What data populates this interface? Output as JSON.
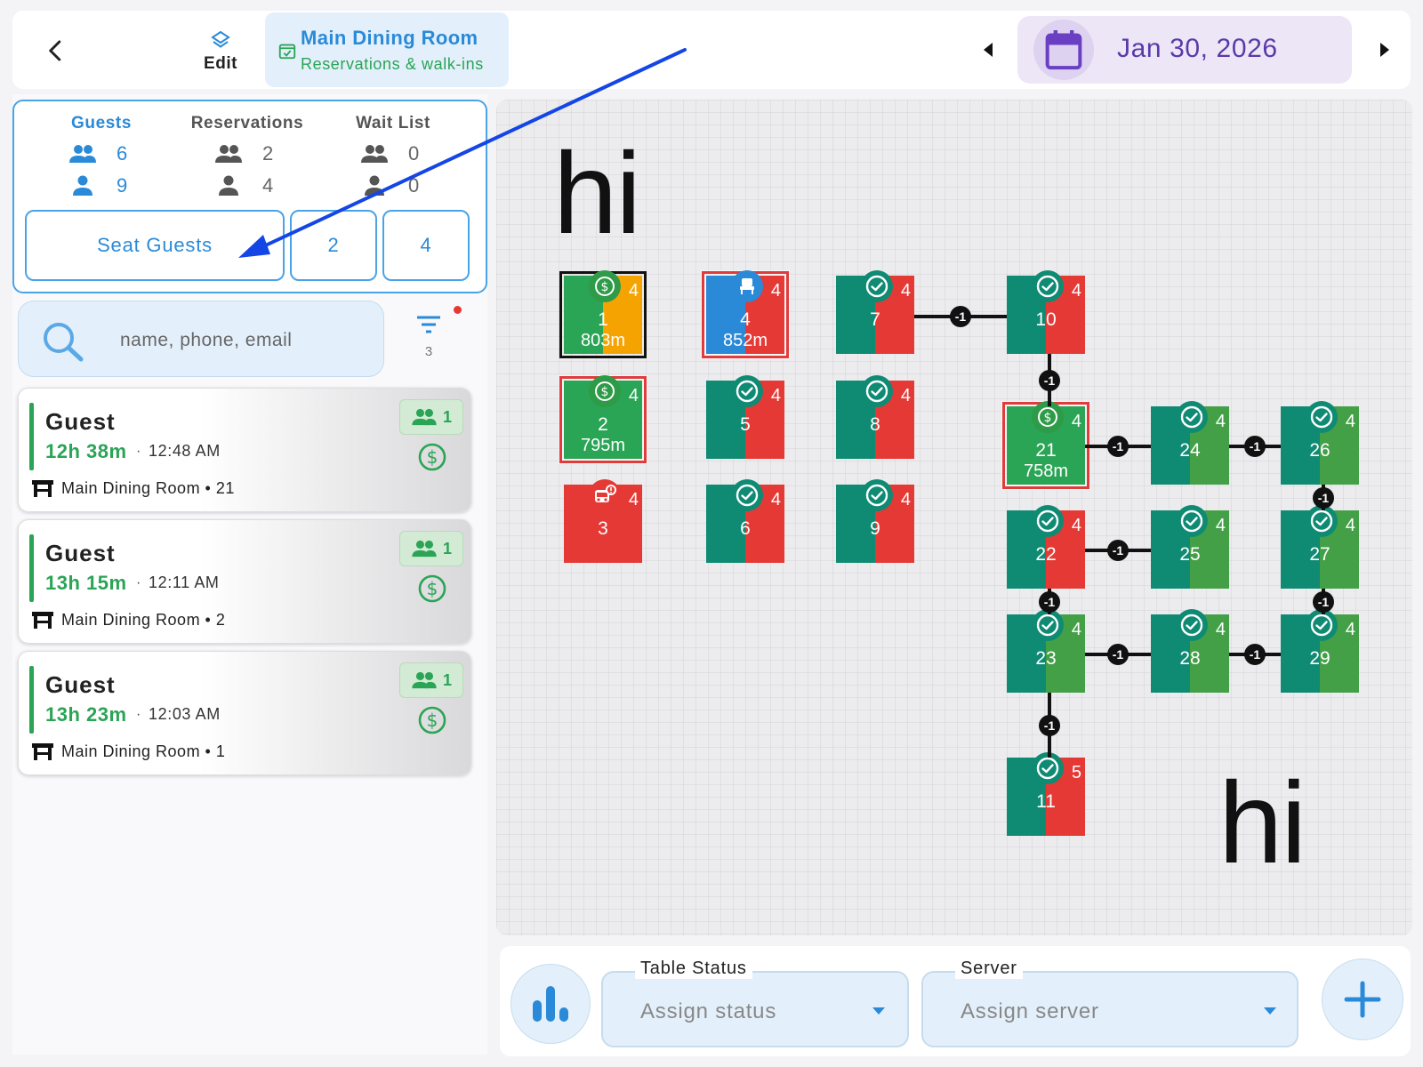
{
  "header": {
    "edit_label": "Edit",
    "room_title": "Main Dining Room",
    "room_subtitle": "Reservations & walk-ins",
    "date": "Jan 30, 2026",
    "icons": [
      "back-arrow-icon",
      "layers-icon",
      "calendar-check-icon",
      "caret-left-icon",
      "calendar-icon",
      "caret-right-icon"
    ]
  },
  "stats": {
    "columns": [
      {
        "label": "Guests",
        "parties": "6",
        "people": "9"
      },
      {
        "label": "Reservations",
        "parties": "2",
        "people": "4"
      },
      {
        "label": "Wait List",
        "parties": "0",
        "people": "0"
      }
    ],
    "seat_button": "Seat Guests",
    "button_2": "2",
    "button_3": "4"
  },
  "search": {
    "placeholder": "name, phone, email",
    "filter_count": "3"
  },
  "guests": [
    {
      "name": "Guest",
      "elapsed": "12h 38m",
      "separator": "·",
      "time": "12:48 AM",
      "location": "Main Dining Room  •  21",
      "party": "1"
    },
    {
      "name": "Guest",
      "elapsed": "13h 15m",
      "separator": "·",
      "time": "12:11 AM",
      "location": "Main Dining Room  •  2",
      "party": "1"
    },
    {
      "name": "Guest",
      "elapsed": "13h 23m",
      "separator": "·",
      "time": "12:03 AM",
      "location": "Main Dining Room  •  1",
      "party": "1"
    }
  ],
  "floor": {
    "labels": [
      "hi",
      "hi"
    ],
    "link_label": "-1",
    "tables": [
      {
        "number": "1",
        "capacity": "4",
        "timer": "803m",
        "status": "paid"
      },
      {
        "number": "4",
        "capacity": "4",
        "timer": "852m",
        "status": "seated"
      },
      {
        "number": "7",
        "capacity": "4",
        "timer": "",
        "status": "available"
      },
      {
        "number": "10",
        "capacity": "4",
        "timer": "",
        "status": "available"
      },
      {
        "number": "2",
        "capacity": "4",
        "timer": "795m",
        "status": "paid"
      },
      {
        "number": "5",
        "capacity": "4",
        "timer": "",
        "status": "available"
      },
      {
        "number": "8",
        "capacity": "4",
        "timer": "",
        "status": "available"
      },
      {
        "number": "21",
        "capacity": "4",
        "timer": "758m",
        "status": "paid"
      },
      {
        "number": "24",
        "capacity": "4",
        "timer": "",
        "status": "available"
      },
      {
        "number": "26",
        "capacity": "4",
        "timer": "",
        "status": "available"
      },
      {
        "number": "3",
        "capacity": "4",
        "timer": "",
        "status": "bus-alert"
      },
      {
        "number": "6",
        "capacity": "4",
        "timer": "",
        "status": "available"
      },
      {
        "number": "9",
        "capacity": "4",
        "timer": "",
        "status": "available"
      },
      {
        "number": "22",
        "capacity": "4",
        "timer": "",
        "status": "available"
      },
      {
        "number": "25",
        "capacity": "4",
        "timer": "",
        "status": "available"
      },
      {
        "number": "27",
        "capacity": "4",
        "timer": "",
        "status": "available"
      },
      {
        "number": "23",
        "capacity": "4",
        "timer": "",
        "status": "available"
      },
      {
        "number": "28",
        "capacity": "4",
        "timer": "",
        "status": "available"
      },
      {
        "number": "29",
        "capacity": "4",
        "timer": "",
        "status": "available"
      },
      {
        "number": "11",
        "capacity": "5",
        "timer": "",
        "status": "available"
      }
    ]
  },
  "bottom": {
    "table_status_label": "Table Status",
    "table_status_value": "Assign status",
    "server_label": "Server",
    "server_value": "Assign server"
  },
  "colors": {
    "accent_blue": "#2a8ad8",
    "green": "#2aa455",
    "teal": "#0f8a73",
    "red": "#e53935",
    "purple": "#5a3aa8",
    "orange": "#f4a300"
  }
}
